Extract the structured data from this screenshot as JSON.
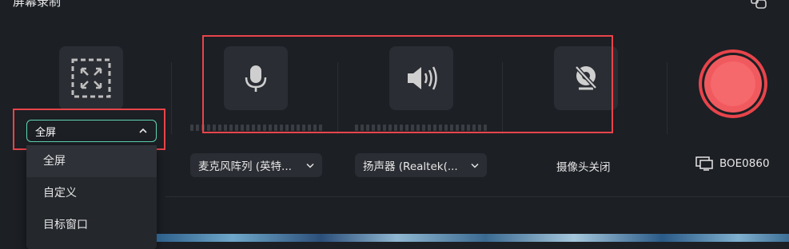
{
  "app": {
    "title": "屏幕录制"
  },
  "capture": {
    "selected": "全屏",
    "options": [
      "全屏",
      "自定义",
      "目标窗口"
    ]
  },
  "audio": {
    "microphone_label": "麦克风阵列 (英特...",
    "speaker_label": "扬声器 (Realtek(..."
  },
  "camera": {
    "label": "摄像头关闭"
  },
  "display": {
    "label": "BOE0860"
  },
  "colors": {
    "accent": "#5fd4b6",
    "record": "#f05a5e",
    "highlight": "#e8444a"
  },
  "icons": [
    "fullscreen-icon",
    "microphone-icon",
    "speaker-icon",
    "camera-off-icon",
    "record-icon",
    "monitor-icon",
    "chevron-up-icon",
    "chevron-down-icon"
  ]
}
